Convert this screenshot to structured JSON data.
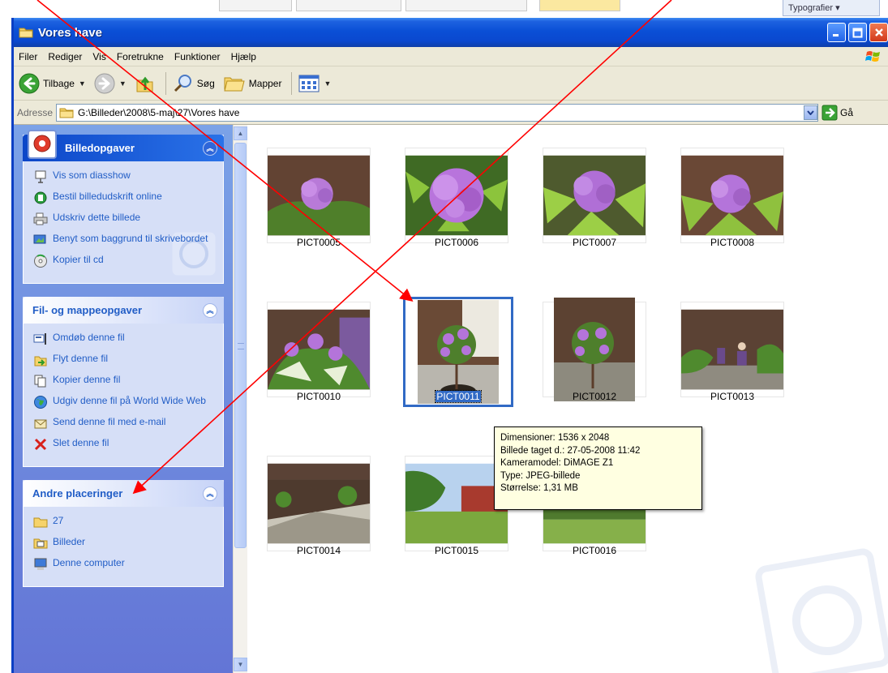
{
  "background": {
    "tab_label": "Typografier ▾"
  },
  "window": {
    "title": "Vores have"
  },
  "menu": [
    "Filer",
    "Rediger",
    "Vis",
    "Foretrukne",
    "Funktioner",
    "Hjælp"
  ],
  "toolbar": {
    "back": "Tilbage",
    "search": "Søg",
    "folders": "Mapper"
  },
  "address": {
    "label": "Adresse",
    "path": "G:\\Billeder\\2008\\5-maj\\27\\Vores have",
    "go": "Gå"
  },
  "panels": {
    "picture_tasks": {
      "title": "Billedopgaver",
      "items": [
        "Vis som diasshow",
        "Bestil billedudskrift online",
        "Udskriv dette billede",
        "Benyt som baggrund til skrivebordet",
        "Kopier til cd"
      ]
    },
    "file_tasks": {
      "title": "Fil- og mappeopgaver",
      "items": [
        "Omdøb denne fil",
        "Flyt denne fil",
        "Kopier denne fil",
        "Udgiv denne fil på World Wide Web",
        "Send denne fil med e-mail",
        "Slet denne fil"
      ]
    },
    "other_places": {
      "title": "Andre placeringer",
      "items": [
        "27",
        "Billeder",
        "Denne computer"
      ]
    }
  },
  "files": [
    {
      "name": "PICT0005"
    },
    {
      "name": "PICT0006"
    },
    {
      "name": "PICT0007"
    },
    {
      "name": "PICT0008"
    },
    {
      "name": "PICT0010"
    },
    {
      "name": "PICT0011",
      "selected": true
    },
    {
      "name": "PICT0012"
    },
    {
      "name": "PICT0013"
    },
    {
      "name": "PICT0014"
    },
    {
      "name": "PICT0015"
    },
    {
      "name": "PICT0016"
    }
  ],
  "tooltip": {
    "dimensions": "Dimensioner: 1536 x 2048",
    "date_taken": "Billede taget d.: 27-05-2008 11:42",
    "camera": "Kameramodel: DiMAGE Z1",
    "type": "Type: JPEG-billede",
    "size": "Størrelse: 1,31 MB"
  },
  "colors": {
    "titlebar": "#0a4fd6",
    "taskpane": "#7ba2e7",
    "link": "#215dc6",
    "selection": "#316ac5",
    "annotation_arrow": "#ff0000",
    "tooltip_bg": "#ffffe1"
  }
}
